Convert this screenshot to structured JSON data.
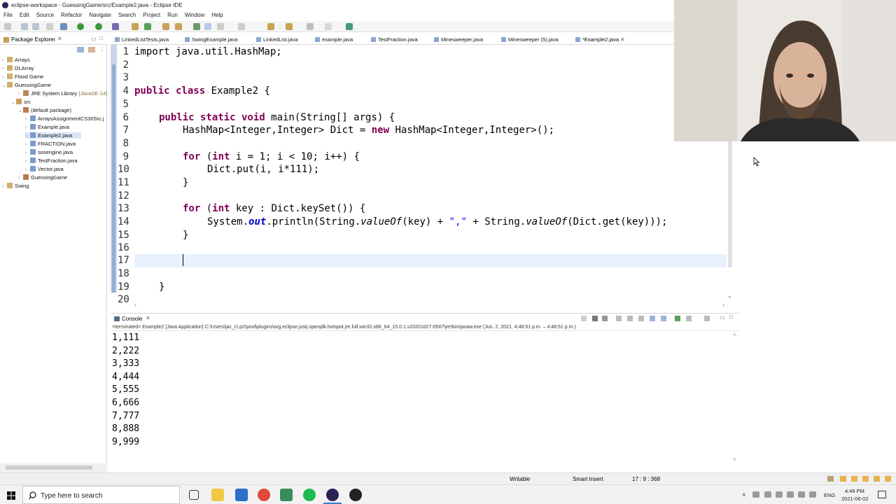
{
  "window": {
    "title": "eclipse-workspace - GuessingGame/src/Example2.java - Eclipse IDE"
  },
  "menu": [
    "File",
    "Edit",
    "Source",
    "Refactor",
    "Navigate",
    "Search",
    "Project",
    "Run",
    "Window",
    "Help"
  ],
  "package_explorer": {
    "title": "Package Explorer",
    "items": [
      "Arrays",
      "DLArray",
      "Flood Game",
      "GuessingGame",
      "JRE System Library",
      "[JavaSE-14]",
      "src",
      "(default package)",
      "ArraysAssignmentCS30Src.j",
      "Example.java",
      "Example2.java",
      "FRACTION.java",
      "sosengine.java",
      "TestFraction.java",
      "Vector.java",
      "GuessingGame",
      "Swing"
    ]
  },
  "editor_tabs": [
    "LinkedListTests.java",
    "SwingExample.java",
    "LinkedList.java",
    "example.java",
    "TestFraction.java",
    "Minesweeper.java",
    "Minesweeper (5).java",
    "*Example2.java"
  ],
  "code_lines": {
    "n": [
      "1",
      "2",
      "3",
      "4",
      "5",
      "6",
      "7",
      "8",
      "9",
      "10",
      "11",
      "12",
      "13",
      "14",
      "15",
      "16",
      "17",
      "18",
      "19",
      "20"
    ],
    "l1": "import java.util.HashMap;",
    "l4a": "public class",
    "l4b": " Example2 {",
    "l6a": "public static void",
    "l6b": " main(String[] args) {",
    "l7a": "HashMap<Integer,Integer> Dict = ",
    "l7b": "new",
    "l7c": " HashMap<Integer,Integer>();",
    "l9a": "for",
    "l9b": " (",
    "l9c": "int",
    "l9d": " i = 1; i < 10; i++) {",
    "l10": "Dict.put(i, i*111);",
    "l11": "}",
    "l13a": "for",
    "l13b": " (",
    "l13c": "int",
    "l13d": " key : Dict.keySet()) {",
    "l14a": "System.",
    "l14b": "out",
    "l14c": ".println(String.",
    "l14d": "valueOf",
    "l14e": "(key) + ",
    "l14f": "\",\"",
    "l14g": " + String.",
    "l14h": "valueOf",
    "l14i": "(Dict.get(key)));",
    "l15": "}",
    "l19": "}"
  },
  "console": {
    "title": "Console",
    "info": "<terminated> Example2 [Java Application] C:\\Users\\jac_c\\.p2\\pool\\plugins\\org.eclipse.justj.openjdk.hotspot.jre.full.win32.x86_64_15.0.1.v20201027-0507\\jre\\bin\\javaw.exe  (Jun. 2, 2021, 4:48:51 p.m. – 4:48:51 p.m.)",
    "output": [
      "1,111",
      "2,222",
      "3,333",
      "4,444",
      "5,555",
      "6,666",
      "7,777",
      "8,888",
      "9,999"
    ]
  },
  "status": {
    "mode": "Writable",
    "insert": "Smart Insert",
    "position": "17 : 9 : 368"
  },
  "taskbar": {
    "search_placeholder": "Type here to search",
    "time": "4:49 PM",
    "date": "2021-06-02",
    "lang": "ENG"
  },
  "colors": {
    "keyword": "#7f0055",
    "string": "#2a00ff",
    "field": "#0000c0",
    "current_line": "#e8f2fe"
  }
}
